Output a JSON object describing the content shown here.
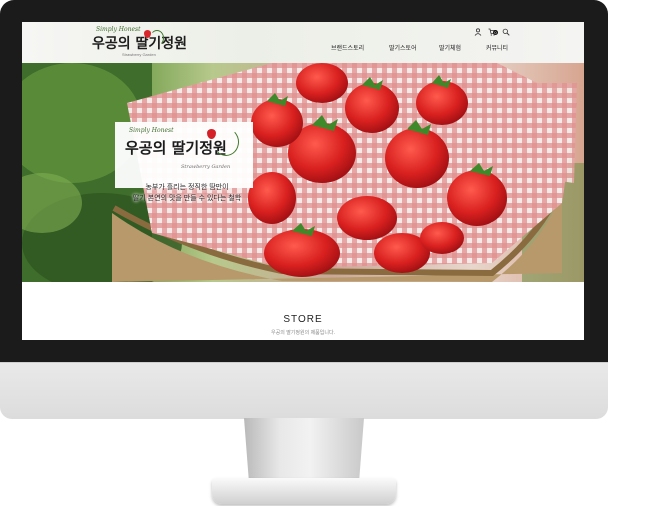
{
  "logo": {
    "tagline": "Simply Honest",
    "name": "우공의 딸기정원",
    "subtitle": "Strawberry Garden"
  },
  "nav": {
    "items": [
      "브랜드스토리",
      "딸기스토어",
      "딸기체험",
      "커뮤니티"
    ]
  },
  "utility": {
    "icons": [
      "user-icon",
      "cart-icon",
      "search-icon"
    ],
    "cart_count": "0"
  },
  "hero": {
    "card": {
      "tagline": "Simply Honest",
      "name": "우공의 딸기정원",
      "subtitle": "Strawberry Garden"
    },
    "copy_line1": "농부가 흘리는 정직한 땀만이",
    "copy_line2": "딸기 본연의 맛을 만들 수 있다는 철학"
  },
  "store": {
    "title": "STORE",
    "subtitle": "우공의 딸기정원의 제품입니다."
  },
  "colors": {
    "accent": "#d42127",
    "leaf": "#3e7a2a",
    "bezel": "#1b1b1b"
  }
}
